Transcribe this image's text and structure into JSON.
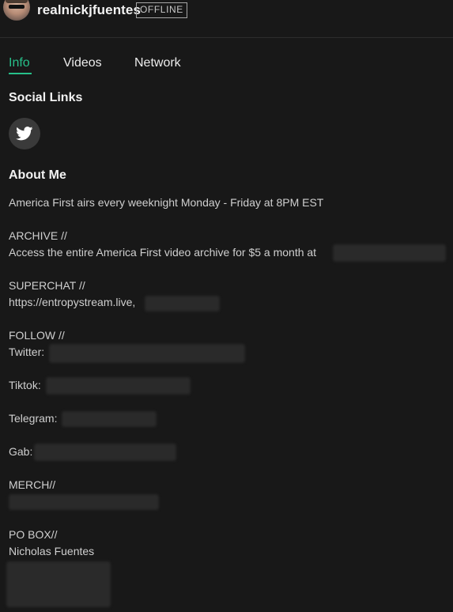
{
  "header": {
    "channel_name": "realnickjfuentes",
    "status": "OFFLINE"
  },
  "tabs": [
    {
      "label": "Info",
      "active": true
    },
    {
      "label": "Videos",
      "active": false
    },
    {
      "label": "Network",
      "active": false
    }
  ],
  "social": {
    "heading": "Social Links",
    "links": [
      {
        "icon": "twitter-icon"
      }
    ]
  },
  "about": {
    "heading": "About Me",
    "intro": "America First airs every weeknight Monday - Friday at 8PM EST",
    "archive_label": "ARCHIVE //",
    "archive_text": "Access the entire America First video archive for $5 a month at",
    "superchat_label": "SUPERCHAT //",
    "superchat_text": "https://entropystream.live,",
    "follow_label": "FOLLOW //",
    "twitter_label": "Twitter:",
    "tiktok_label": "Tiktok:",
    "telegram_label": "Telegram:",
    "gab_label": "Gab:",
    "merch_label": "MERCH//",
    "pobox_label": "PO BOX//",
    "pobox_name": "Nicholas Fuentes"
  },
  "colors": {
    "background": "#181818",
    "accent": "#27c08a",
    "text": "#cfcfcf",
    "redaction": "#2a2a2a"
  }
}
